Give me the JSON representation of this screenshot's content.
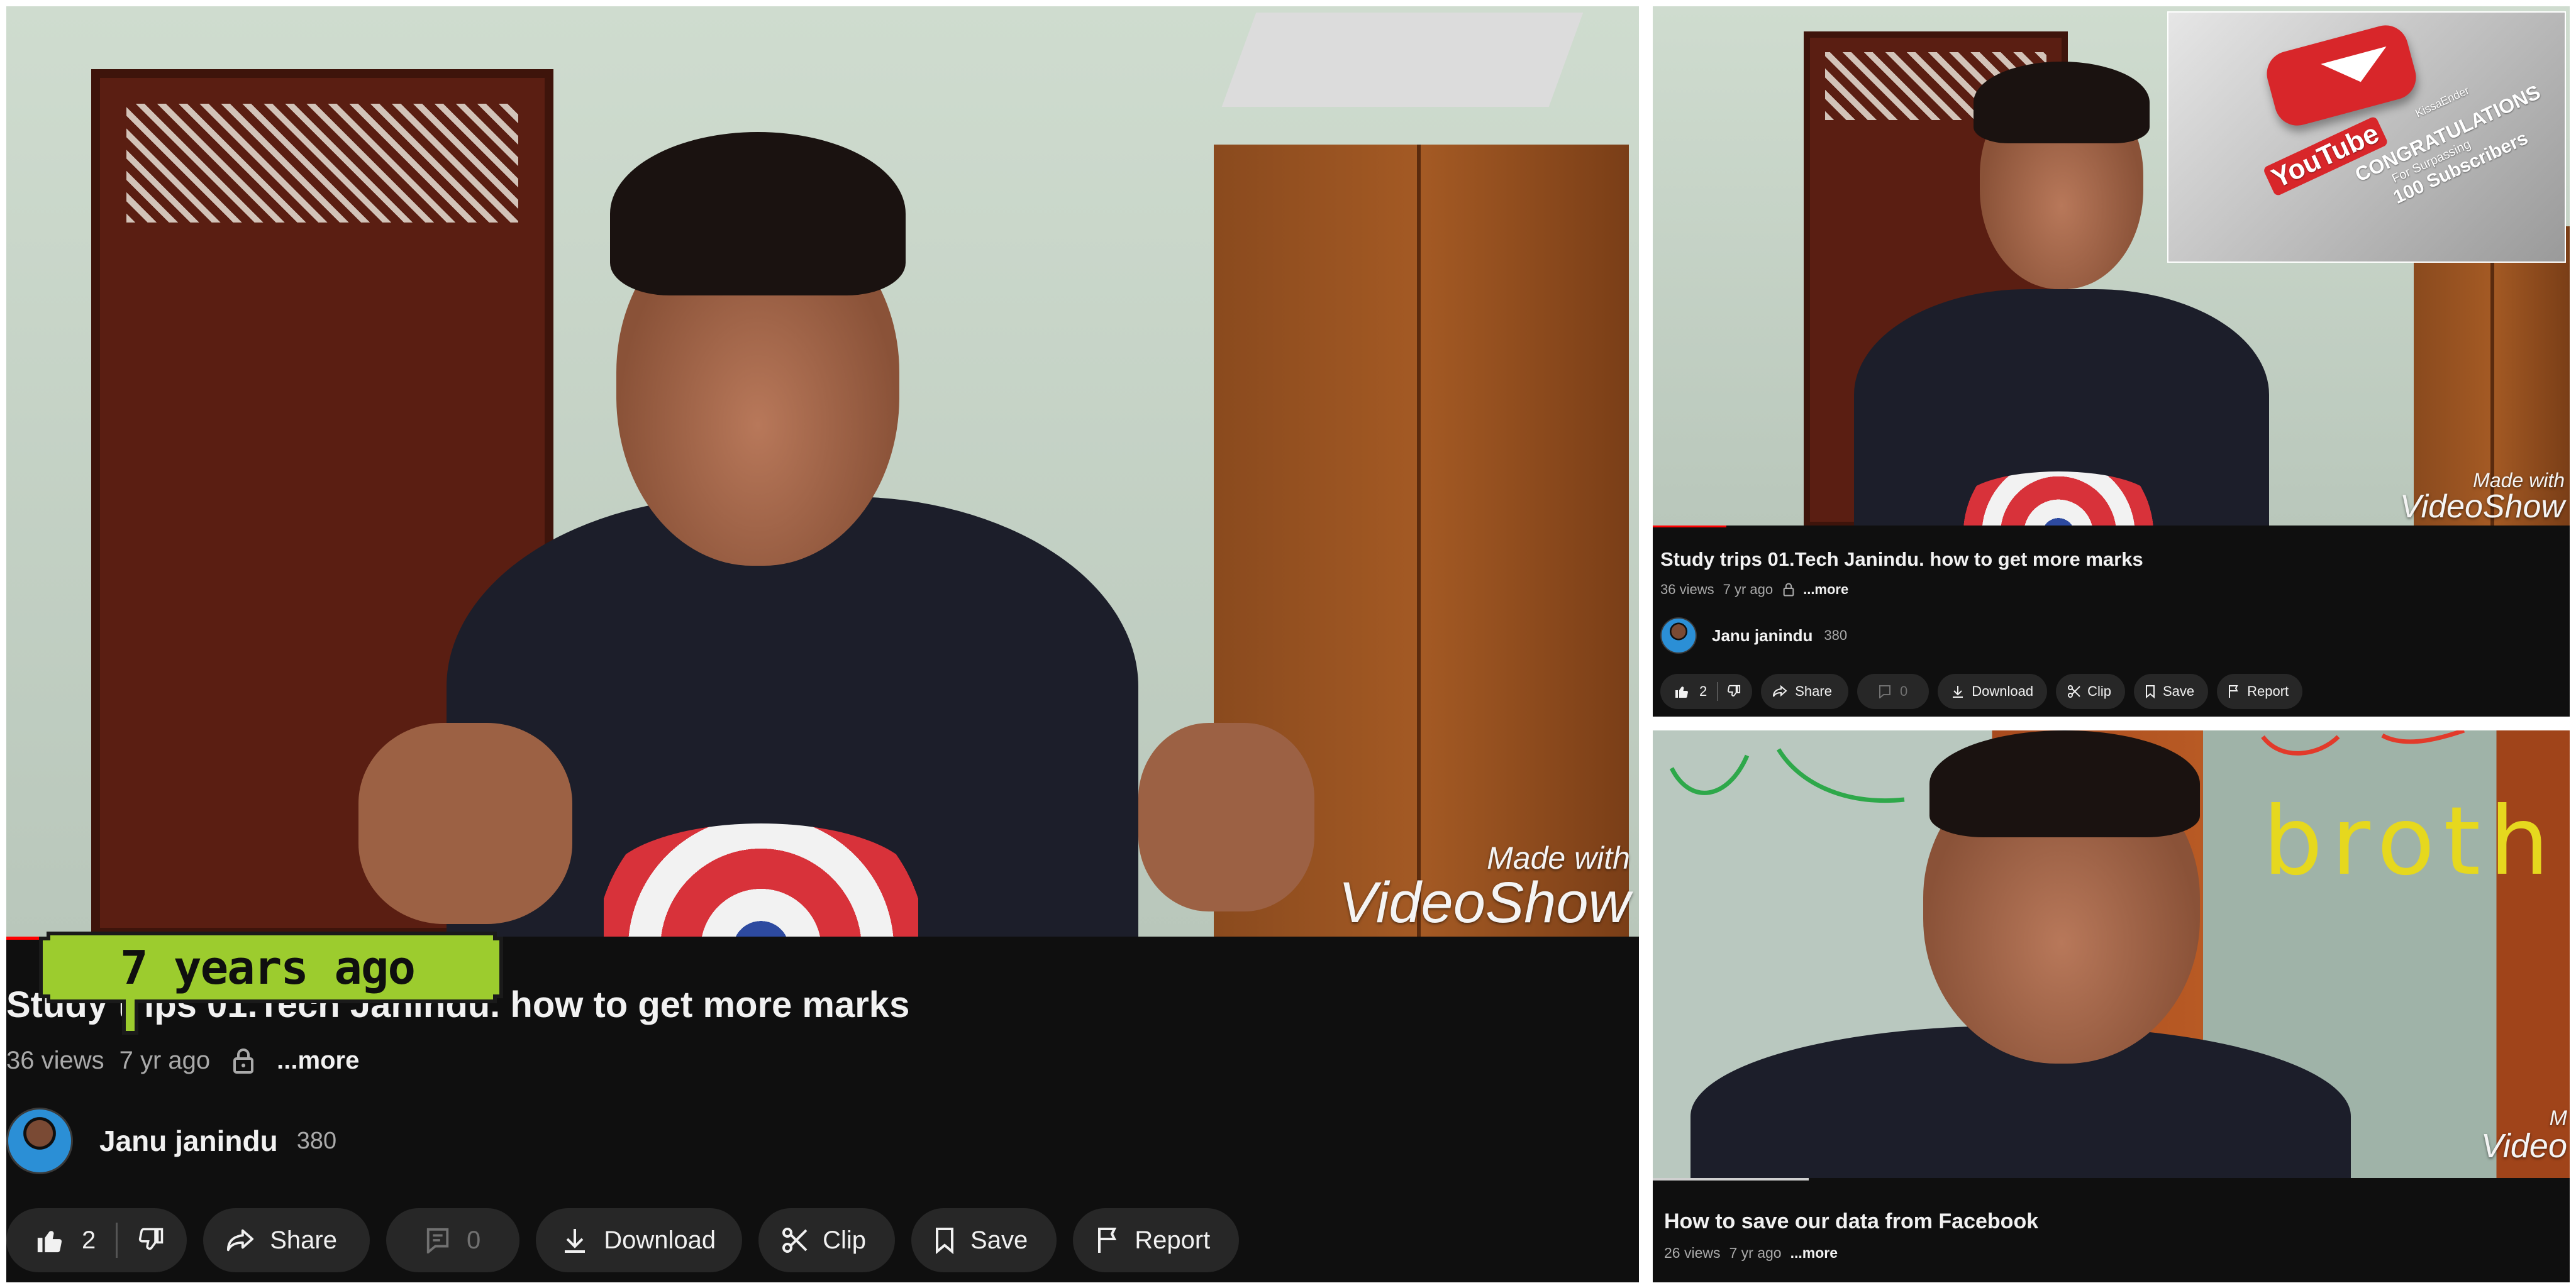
{
  "main": {
    "title": "Study trips 01.Tech Janindu. how to get more marks",
    "views": "36 views",
    "age": "7 yr ago",
    "more": "...more",
    "channel": "Janu janindu",
    "subscribers": "380",
    "likes": "2",
    "share": "Share",
    "comments": "0",
    "download": "Download",
    "clip": "Clip",
    "save": "Save",
    "report": "Report",
    "watermark_line1": "Made with",
    "watermark_line2": "VideoShow",
    "sticker": "7 years ago"
  },
  "top_right": {
    "title": "Study trips 01.Tech Janindu. how to get more marks",
    "views": "36 views",
    "age": "7 yr ago",
    "more": "...more",
    "channel": "Janu janindu",
    "subscribers": "380",
    "likes": "2",
    "share": "Share",
    "comments": "0",
    "download": "Download",
    "clip": "Clip",
    "save": "Save",
    "report": "Report",
    "watermark_line1": "Made with",
    "watermark_line2": "VideoShow",
    "inset": {
      "brand": "YouTube",
      "congrats": "CONGRATULATIONS",
      "for_surpassing": "For Surpassing",
      "subscribers": "100 Subscribers",
      "name": "KissaEnder"
    }
  },
  "bottom_right": {
    "title": "How to save our data from Facebook",
    "views": "26 views",
    "age": "7 yr ago",
    "more": "...more",
    "board_word": "broth",
    "watermark_line1": "M",
    "watermark_line2": "Video"
  },
  "colors": {
    "panel_bg": "#0f0f0f",
    "pill_bg": "#272727",
    "text_primary": "#f1f1f1",
    "text_secondary": "#aaaaaa",
    "sticker_green": "#9ccc2e",
    "progress_red": "#ff0000"
  }
}
